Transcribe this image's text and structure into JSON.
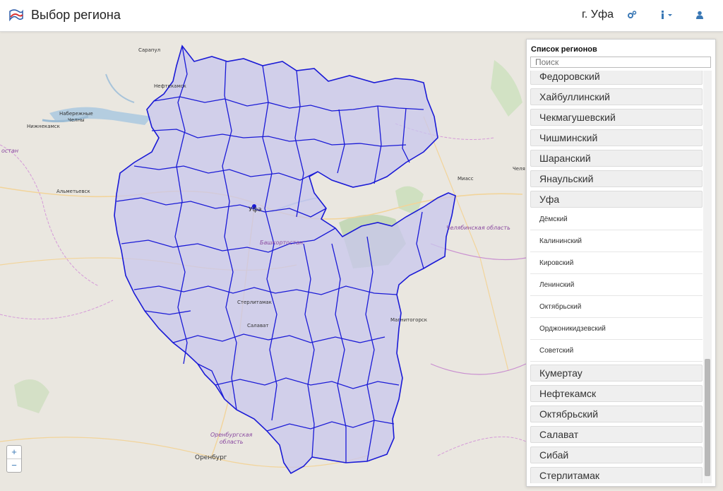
{
  "header": {
    "title": "Выбор региона",
    "city": "г. Уфа",
    "icons": [
      "logo-icon",
      "settings-icon",
      "info-icon",
      "user-icon"
    ]
  },
  "map": {
    "labels": {
      "sarapul": "Сарапул",
      "neftekamsk": "Нефтекамск",
      "nab_chelny": "Набережные\nЧелны",
      "nizhnekamsk": "Нижнекамск",
      "tatarstan": "остан",
      "almetyevsk": "Альметьевск",
      "ufa": "Уфа",
      "bashkortostan": "Башкортостан",
      "sterlitamak": "Стерлитамак",
      "salavat": "Салават",
      "magnitogorsk": "Магнитогорск",
      "chelyabinsk_obl": "Челябинская область",
      "miass": "Миасс",
      "chel": "Челя",
      "orenburg_obl": "Оренбургская\nобласть",
      "orenburg": "Оренбург"
    },
    "zoom_in": "+",
    "zoom_out": "−"
  },
  "panel": {
    "title": "Список регионов",
    "search_placeholder": "Поиск",
    "items_before": [
      "Федоровский",
      "Хайбуллинский",
      "Чекмагушевский",
      "Чишминский",
      "Шаранский",
      "Янаульский",
      "Уфа"
    ],
    "subitems": [
      "Дёмский",
      "Калининский",
      "Кировский",
      "Ленинский",
      "Октябрьский",
      "Орджоникидзевский",
      "Советский"
    ],
    "items_after": [
      "Кумертау",
      "Нефтекамск",
      "Октябрьский",
      "Салават",
      "Сибай",
      "Стерлитамак"
    ]
  },
  "colors": {
    "region_fill": "#c9c8f0",
    "region_stroke": "#1a1ad6",
    "accent": "#3a78b5"
  }
}
